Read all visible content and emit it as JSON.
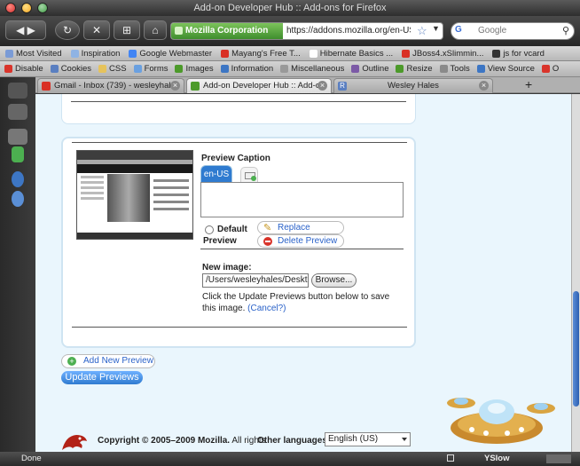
{
  "window": {
    "title": "Add-on Developer Hub :: Add-ons for Firefox"
  },
  "navbar": {
    "identity_label": "Mozilla Corporation (US)",
    "url": "https://addons.mozilla.org/en-US/d",
    "search_placeholder": "Google",
    "search_engine_label": "G"
  },
  "bookmarks": [
    {
      "label": "Most Visited",
      "color": "#7a9bd6"
    },
    {
      "label": "Inspiration",
      "color": "#8fb3e3"
    },
    {
      "label": "Google Webmaster",
      "color": "#4285f4"
    },
    {
      "label": "Mayang's Free T...",
      "color": "#d93025"
    },
    {
      "label": "Hibernate Basics ...",
      "color": "#ffffff"
    },
    {
      "label": "JBoss4.xSlimmin...",
      "color": "#d93025"
    },
    {
      "label": "js for vcard",
      "color": "#333333"
    }
  ],
  "webdev_toolbar": [
    {
      "label": "Disable",
      "color": "#d9342b"
    },
    {
      "label": "Cookies",
      "color": "#5a7fc1"
    },
    {
      "label": "CSS",
      "color": "#e6c35c"
    },
    {
      "label": "Forms",
      "color": "#6aa0e0"
    },
    {
      "label": "Images",
      "color": "#4c9a2a"
    },
    {
      "label": "Information",
      "color": "#3d76c4"
    },
    {
      "label": "Miscellaneous",
      "color": "#999999"
    },
    {
      "label": "Outline",
      "color": "#7c5aa6"
    },
    {
      "label": "Resize",
      "color": "#4c9a2a"
    },
    {
      "label": "Tools",
      "color": "#8a8a8a"
    },
    {
      "label": "View Source",
      "color": "#3d76c4"
    },
    {
      "label": "O",
      "color": "#d9342b"
    }
  ],
  "tabs": [
    {
      "label": "Gmail - Inbox (739) - wesleyhal...",
      "active": false,
      "color": "#d93025"
    },
    {
      "label": "Add-on Developer Hub :: Add-o...",
      "active": true,
      "color": "#4c9a2a"
    },
    {
      "label": "R",
      "active": false,
      "color": "#5a7fc1"
    },
    {
      "label": "Wesley Hales",
      "active": false,
      "color": "#b0b0b0"
    }
  ],
  "preview_form": {
    "caption_label": "Preview Caption",
    "locale_tab": "en-US",
    "default_label": "Default",
    "preview_label": "Preview",
    "replace_label": "Replace Preview",
    "delete_label": "Delete Preview",
    "new_image_label": "New image:",
    "file_value": "/Users/wesleyhales/Deskto",
    "browse_label": "Browse...",
    "hint_text": "Click the Update Previews button below to save this image.",
    "cancel_label": "(Cancel?)"
  },
  "actions": {
    "add_new_label": "Add New Preview",
    "update_label": "Update Previews"
  },
  "footer": {
    "copyright": "Copyright © 2005–2009 Mozilla.",
    "rights": "All rights",
    "other_languages_label": "Other languages:",
    "language_value": "English (US)"
  },
  "statusbar": {
    "status": "Done",
    "yslow_label": "YSlow"
  },
  "colors": {
    "accent": "#2f7bd0",
    "link": "#2a62c9",
    "content_bg": "#eaf6fd",
    "identity": "#3f8d2d"
  }
}
